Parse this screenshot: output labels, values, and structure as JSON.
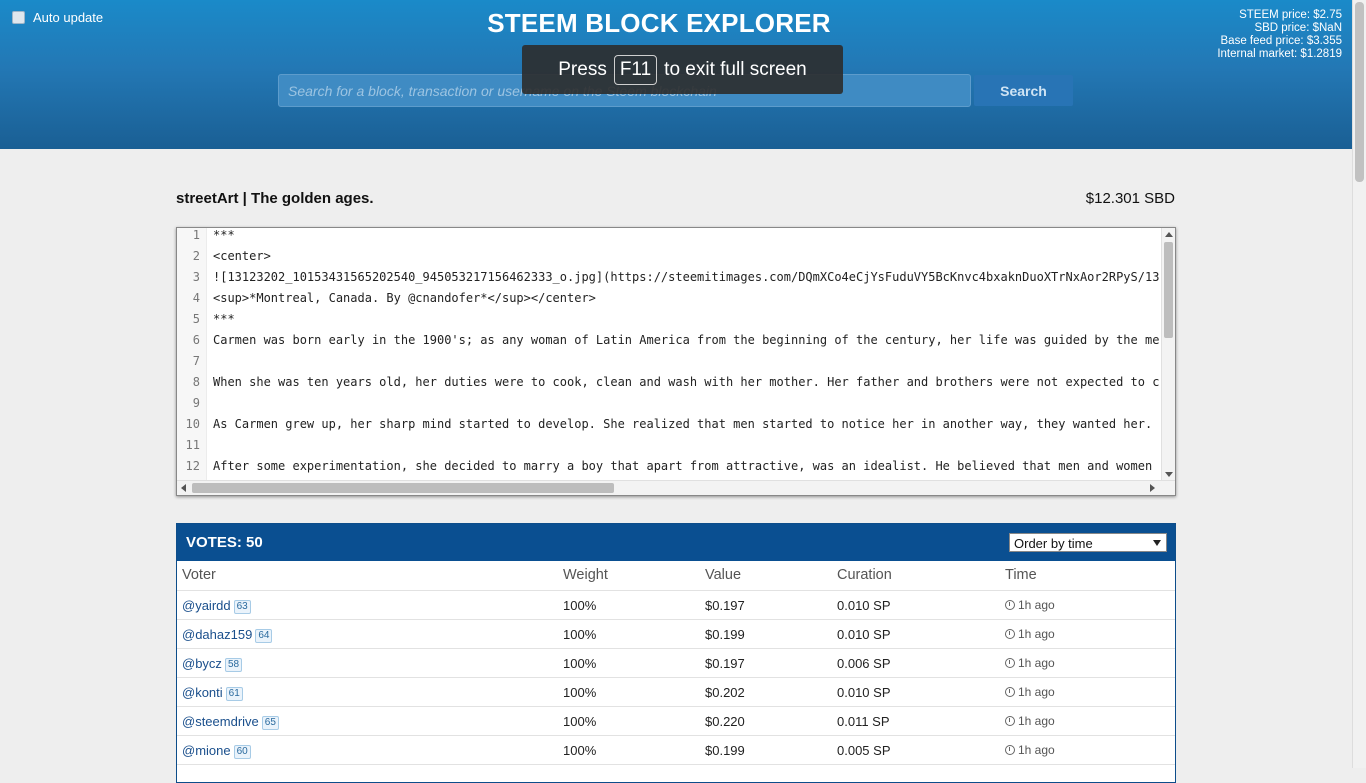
{
  "header": {
    "auto_update_label": "Auto update",
    "site_title": "STEEM BLOCK EXPLORER",
    "prices": [
      "STEEM price: $2.75",
      "SBD price: $NaN",
      "Base feed price: $3.355",
      "Internal market: $1.2819"
    ],
    "search_placeholder": "Search for a block, transaction or username on the Steem blockchain",
    "search_button": "Search"
  },
  "fullscreen_notice": {
    "prefix": "Press",
    "key": "F11",
    "suffix": "to exit full screen"
  },
  "post": {
    "title": "streetArt | The golden ages.",
    "value": "$12.301 SBD",
    "lines": [
      {
        "n": "1",
        "text": "***"
      },
      {
        "n": "2",
        "text": "<center>"
      },
      {
        "n": "3",
        "text": "![13123202_10153431565202540_945053217156462333_o.jpg](https://steemitimages.com/DQmXCo4eCjYsFuduVY5BcKnvc4bxaknDuoXTrNxAor2RPyS/13"
      },
      {
        "n": "4",
        "text": "<sup>*Montreal, Canada. By @cnandofer*</sup></center>"
      },
      {
        "n": "5",
        "text": "***"
      },
      {
        "n": "6",
        "text": "Carmen was born early in the 1900's; as any woman of Latin America from the beginning of the century, her life was guided by the me"
      },
      {
        "n": "7",
        "text": ""
      },
      {
        "n": "8",
        "text": "When she was ten years old, her duties were to cook, clean and wash with her mother. Her father and brothers were not expected to c"
      },
      {
        "n": "9",
        "text": ""
      },
      {
        "n": "10",
        "text": "As Carmen grew up, her sharp mind started to develop. She realized that men started to notice her in another way, they wanted her."
      },
      {
        "n": "11",
        "text": ""
      },
      {
        "n": "12",
        "text": "After some experimentation, she decided to marry a boy that apart from attractive, was an idealist. He believed that men and women"
      }
    ]
  },
  "votes": {
    "title": "VOTES: 50",
    "order_select": "Order by time",
    "columns": [
      "Voter",
      "Weight",
      "Value",
      "Curation",
      "Time"
    ],
    "rows": [
      {
        "voter": "@yairdd",
        "rep": "63",
        "weight": "100%",
        "value": "$0.197",
        "curation": "0.010 SP",
        "time": "1h ago"
      },
      {
        "voter": "@dahaz159",
        "rep": "64",
        "weight": "100%",
        "value": "$0.199",
        "curation": "0.010 SP",
        "time": "1h ago"
      },
      {
        "voter": "@bycz",
        "rep": "58",
        "weight": "100%",
        "value": "$0.197",
        "curation": "0.006 SP",
        "time": "1h ago"
      },
      {
        "voter": "@konti",
        "rep": "61",
        "weight": "100%",
        "value": "$0.202",
        "curation": "0.010 SP",
        "time": "1h ago"
      },
      {
        "voter": "@steemdrive",
        "rep": "65",
        "weight": "100%",
        "value": "$0.220",
        "curation": "0.011 SP",
        "time": "1h ago"
      },
      {
        "voter": "@mione",
        "rep": "60",
        "weight": "100%",
        "value": "$0.199",
        "curation": "0.005 SP",
        "time": "1h ago"
      }
    ]
  }
}
